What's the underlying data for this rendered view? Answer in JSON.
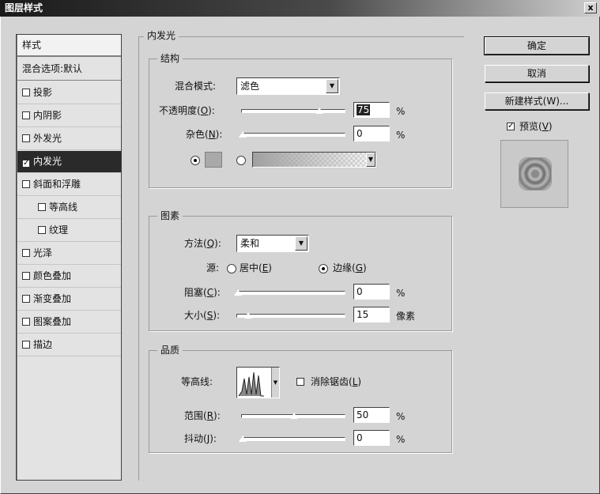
{
  "window": {
    "title": "图层样式",
    "close_label": "x"
  },
  "style_list": {
    "header": "样式",
    "blend": "混合选项:默认",
    "items": [
      {
        "label": "投影",
        "checked": false
      },
      {
        "label": "内阴影",
        "checked": false
      },
      {
        "label": "外发光",
        "checked": false
      },
      {
        "label": "内发光",
        "checked": true
      },
      {
        "label": "斜面和浮雕",
        "checked": false
      },
      {
        "label": "等高线",
        "checked": false
      },
      {
        "label": "纹理",
        "checked": false
      },
      {
        "label": "光泽",
        "checked": false
      },
      {
        "label": "颜色叠加",
        "checked": false
      },
      {
        "label": "渐变叠加",
        "checked": false
      },
      {
        "label": "图案叠加",
        "checked": false
      },
      {
        "label": "描边",
        "checked": false
      }
    ],
    "check_mark": "✓"
  },
  "panel": {
    "title": "内发光",
    "structure": {
      "title": "结构",
      "blend_mode_label": "混合模式:",
      "blend_mode_value": "滤色",
      "opacity_label_pre": "不透明度(",
      "opacity_key": "O",
      "opacity_label_post": "):",
      "opacity_value": "75",
      "opacity_unit": "%",
      "noise_label_pre": "杂色(",
      "noise_key": "N",
      "noise_label_post": "):",
      "noise_value": "0",
      "noise_unit": "%"
    },
    "elements": {
      "title": "图素",
      "technique_label_pre": "方法(",
      "technique_key": "Q",
      "technique_label_post": "):",
      "technique_value": "柔和",
      "source_label": "源:",
      "source_center_pre": "居中(",
      "source_center_key": "E",
      "source_center_post": ")",
      "source_edge_pre": "边缘(",
      "source_edge_key": "G",
      "source_edge_post": ")",
      "choke_label_pre": "阻塞(",
      "choke_key": "C",
      "choke_label_post": "):",
      "choke_value": "0",
      "choke_unit": "%",
      "size_label_pre": "大小(",
      "size_key": "S",
      "size_label_post": "):",
      "size_value": "15",
      "size_unit": "像素"
    },
    "quality": {
      "title": "品质",
      "contour_label": "等高线:",
      "antialias_label_pre": "消除锯齿(",
      "antialias_key": "L",
      "antialias_label_post": ")",
      "range_label_pre": "范围(",
      "range_key": "R",
      "range_label_post": "):",
      "range_value": "50",
      "range_unit": "%",
      "jitter_label_pre": "抖动(",
      "jitter_key": "J",
      "jitter_label_post": "):",
      "jitter_value": "0",
      "jitter_unit": "%"
    }
  },
  "buttons": {
    "ok": "确定",
    "cancel": "取消",
    "new_style": "新建样式(W)..."
  },
  "preview": {
    "label_pre": "预览(",
    "label_key": "V",
    "label_post": ")",
    "checked": true,
    "check_mark": "✓"
  },
  "sliders": {
    "opacity": 0.75,
    "noise": 0,
    "choke": 0,
    "size": 0.1,
    "range": 0.5,
    "jitter": 0
  }
}
